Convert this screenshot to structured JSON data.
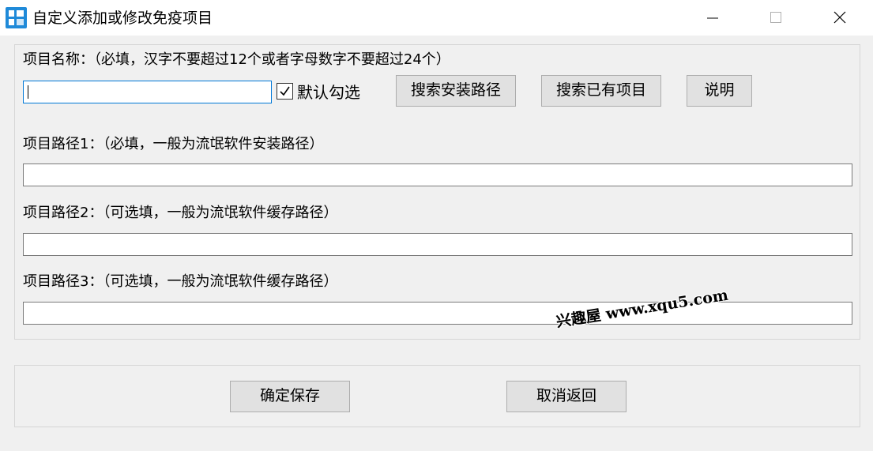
{
  "window": {
    "title": "自定义添加或修改免疫项目",
    "icon": "app-logo-icon",
    "controls": [
      "minimize-icon",
      "maximize-icon",
      "close-icon"
    ]
  },
  "name_section": {
    "label": "项目名称：（必填，汉字不要超过12个或者字母数字不要超过24个）",
    "value": "",
    "checkbox_label": "默认勾选",
    "checkbox_checked": true,
    "buttons": {
      "search_install": "搜索安装路径",
      "search_existing": "搜索已有项目",
      "help": "说明"
    }
  },
  "paths": [
    {
      "label": "项目路径1：（必填，一般为流氓软件安装路径）",
      "value": ""
    },
    {
      "label": "项目路径2：（可选填，一般为流氓软件缓存路径）",
      "value": ""
    },
    {
      "label": "项目路径3：（可选填，一般为流氓软件缓存路径）",
      "value": ""
    }
  ],
  "footer": {
    "save": "确定保存",
    "cancel": "取消返回"
  },
  "watermark": "兴趣屋 www.xqu5.com",
  "colors": {
    "window_bg": "#f0f0f0",
    "titlebar_bg": "#ffffff",
    "button_bg": "#e1e1e1",
    "button_border": "#adadad",
    "focus_border": "#0078d7",
    "icon_blue": "#1f8ad9"
  }
}
